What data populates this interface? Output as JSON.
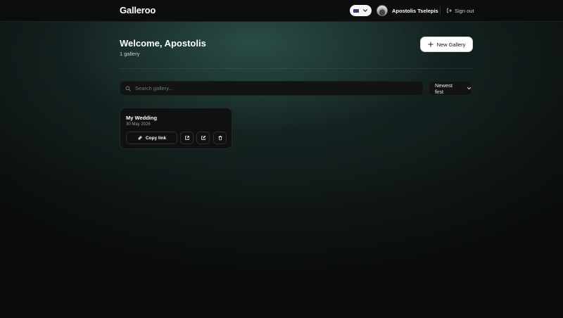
{
  "app": {
    "brand": "Galleroo"
  },
  "header": {
    "language_flag": "uk-flag-icon",
    "user_name": "Apostolis Tselepis",
    "signout_label": "Sign out"
  },
  "main": {
    "welcome": "Welcome, Apostolis",
    "gallery_count": "1 gallery",
    "new_gallery_label": "New Gallery",
    "search_placeholder": "Search gallery...",
    "sort_label": "Newest first"
  },
  "galleries": [
    {
      "title": "My Wedding",
      "date": "30 May 2026",
      "copy_label": "Copy link"
    }
  ],
  "colors": {
    "accent_bg": "#ffffff",
    "page_bg": "#0a0b0b",
    "glow": "#2e544e"
  }
}
